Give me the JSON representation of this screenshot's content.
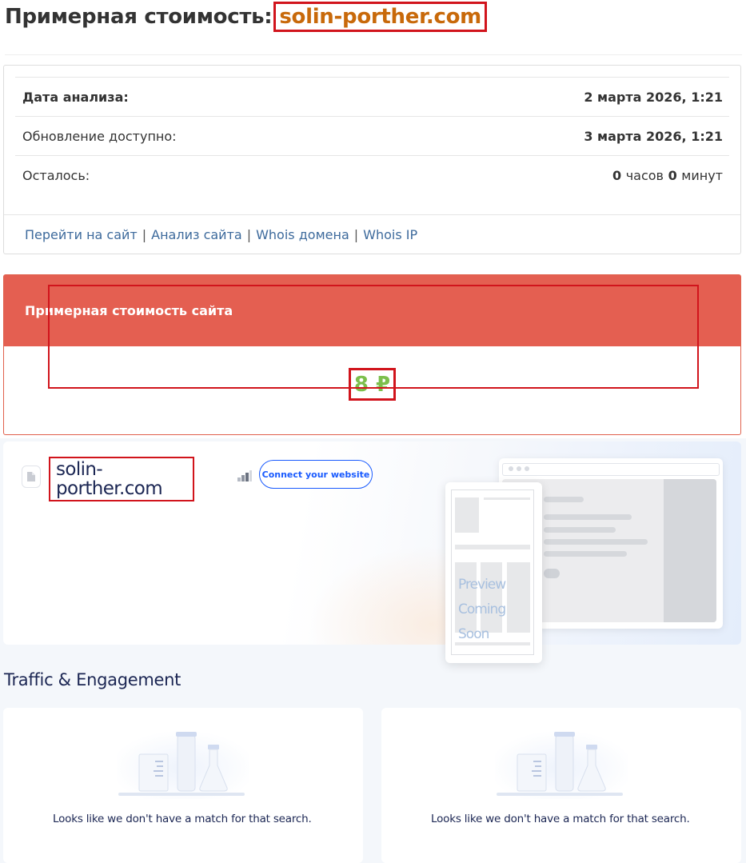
{
  "header": {
    "title_prefix": "Примерная стоимость:",
    "domain": "solin-porther.com"
  },
  "info": {
    "rows": [
      {
        "label": "Дата анализа:",
        "value": "2 марта 2026, 1:21"
      },
      {
        "label": "Обновление доступно:",
        "value": "3 марта 2026, 1:21"
      },
      {
        "label": "Осталось:",
        "hours": "0",
        "hours_unit": "часов",
        "minutes": "0",
        "minutes_unit": "минут"
      }
    ],
    "links": [
      "Перейти на сайт",
      "Анализ сайта",
      "Whois домена",
      "Whois IP"
    ],
    "separator": "|"
  },
  "cost": {
    "heading": "Примерная стоимость сайта",
    "value": "8 ₽",
    "value_color": "#7cbf4c",
    "header_color": "#e45f51"
  },
  "similarweb": {
    "domain_line1": "solin-",
    "domain_line2": "porther.com",
    "connect_button": "Connect your website",
    "preview_line1": "Preview",
    "preview_line2": "Coming Soon",
    "section_title": "Traffic & Engagement",
    "cards": [
      {
        "message": "Looks like we don't have a match for that search."
      },
      {
        "message": "Looks like we don't have a match for that search."
      }
    ],
    "accent_color": "#195afe",
    "text_color": "#1b2653"
  },
  "icons": [
    "page-icon",
    "rank-bars-icon",
    "empty-lab-illustration"
  ]
}
